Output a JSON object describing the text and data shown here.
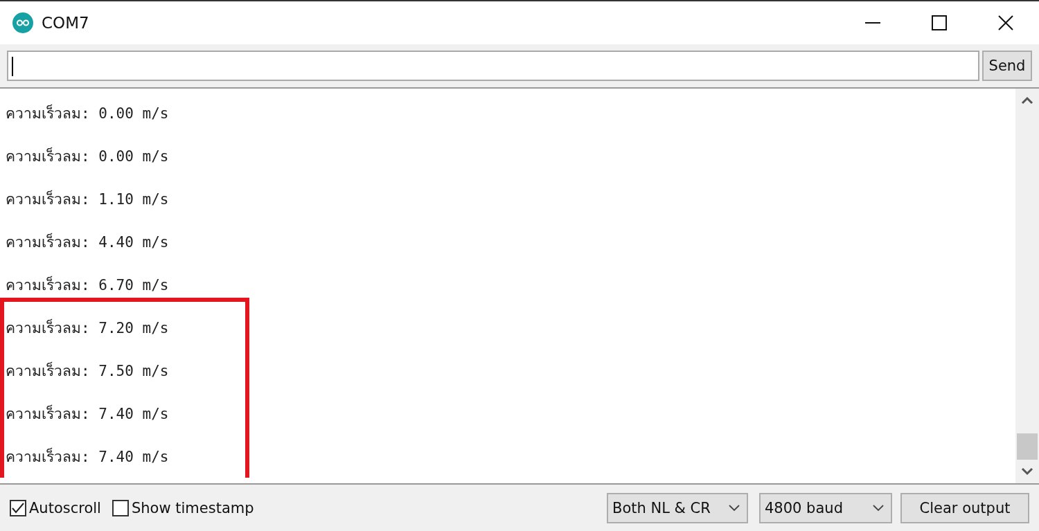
{
  "window": {
    "title": "COM7"
  },
  "send_button": "Send",
  "lines": [
    {
      "text": "ความเร็วลม: 0.00 m/s",
      "highlighted": false
    },
    {
      "text": "ความเร็วลม: 0.00 m/s",
      "highlighted": false
    },
    {
      "text": "ความเร็วลม: 1.10 m/s",
      "highlighted": false
    },
    {
      "text": "ความเร็วลม: 4.40 m/s",
      "highlighted": false
    },
    {
      "text": "ความเร็วลม: 6.70 m/s",
      "highlighted": false
    },
    {
      "text": "ความเร็วลม: 7.20 m/s",
      "highlighted": true
    },
    {
      "text": "ความเร็วลม: 7.50 m/s",
      "highlighted": true
    },
    {
      "text": "ความเร็วลม: 7.40 m/s",
      "highlighted": true
    },
    {
      "text": "ความเร็วลม: 7.40 m/s",
      "highlighted": true
    }
  ],
  "options": [
    {
      "label": "Autoscroll",
      "checked": true
    },
    {
      "label": "Show timestamp",
      "checked": false
    }
  ],
  "line_ending": "Both NL & CR",
  "baud_rate": "4800 baud",
  "clear_button": "Clear output"
}
